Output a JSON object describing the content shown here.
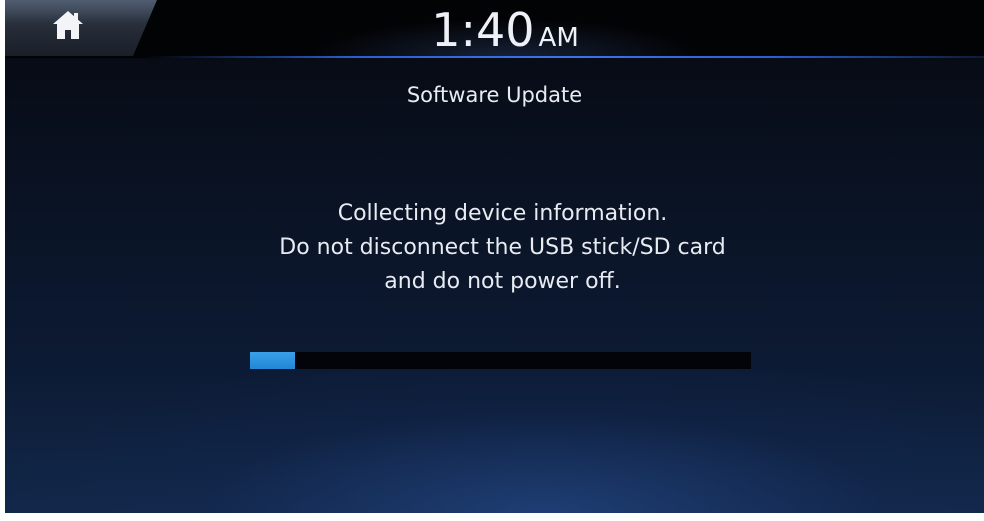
{
  "statusbar": {
    "time": "1:40",
    "ampm": "AM"
  },
  "page": {
    "title": "Software Update"
  },
  "message": {
    "lines": [
      "Collecting device information.",
      "Do not disconnect the USB stick/SD card",
      "and do not power off."
    ]
  },
  "progress": {
    "percent": 9,
    "color": "#2b8ee0"
  },
  "icons": {
    "home": "home-icon"
  },
  "colors": {
    "background": "#0a1222",
    "accent_line": "#3b74ea",
    "text": "#e8ecf2"
  }
}
